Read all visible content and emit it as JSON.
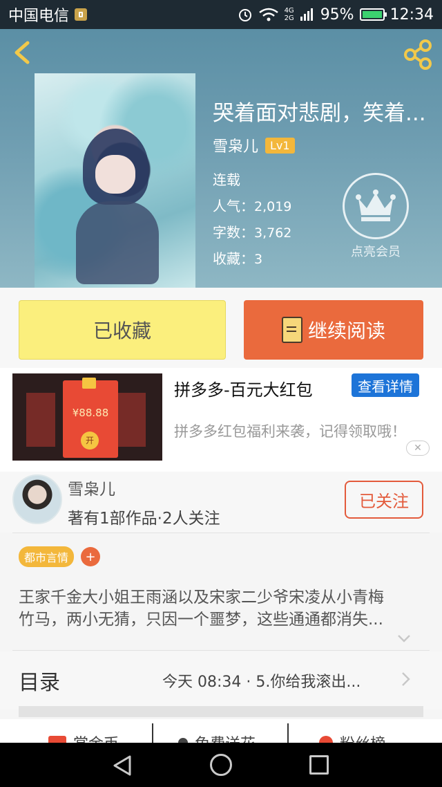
{
  "status_bar": {
    "carrier": "中国电信",
    "network_top": "4G",
    "network_bottom": "2G",
    "battery": "95%",
    "time": "12:34"
  },
  "book": {
    "title": "哭着面对悲剧，笑着...",
    "author": "雪枭儿",
    "level": "Lv1",
    "status": "连载",
    "popularity_label": "人气：",
    "popularity_value": "2,019",
    "word_count_label": "字数：",
    "word_count_value": "3,762",
    "favorites_label": "收藏：",
    "favorites_value": "3",
    "vip_label": "点亮会员"
  },
  "actions": {
    "favorite_label": "已收藏",
    "read_label": "继续阅读"
  },
  "ad": {
    "title": "拼多多-百元大红包",
    "button_label": "查看详情",
    "description": "拼多多红包福利来袭，记得领取哦！",
    "amount": "¥88.88",
    "open_label": "开"
  },
  "author_row": {
    "name": "雪枭儿",
    "subtitle": "著有1部作品·2人关注",
    "follow_label": "已关注"
  },
  "tags": [
    "都市言情"
  ],
  "tag_add": "+",
  "intro": {
    "line1": "王家千金大小姐王雨涵以及宋家二少爷宋凌从小青梅",
    "line2": "竹马，两小无猜，只因一个噩梦，这些通通都消失..."
  },
  "catalog": {
    "title": "目录",
    "latest": "今天 08:34 · 5.你给我滚出..."
  },
  "bottom_tabs": [
    "赏金币",
    "免费送花",
    "粉丝榜"
  ],
  "colors": {
    "accent_orange": "#ea6a3d",
    "favorite_yellow": "#fbef7d",
    "level_badge": "#f3b73b",
    "ad_button_blue": "#1d74d8"
  }
}
